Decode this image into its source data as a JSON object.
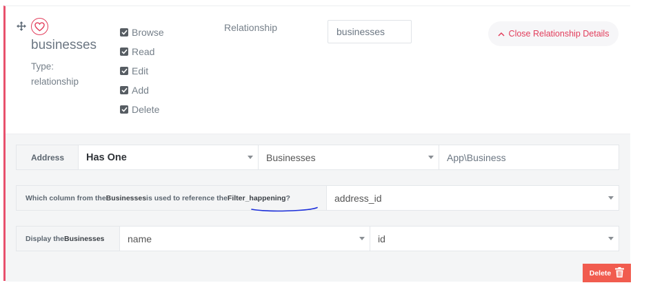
{
  "field": {
    "name": "businesses",
    "type_label": "Type:",
    "type_value": "relationship"
  },
  "permissions": [
    {
      "label": "Browse",
      "checked": true
    },
    {
      "label": "Read",
      "checked": true
    },
    {
      "label": "Edit",
      "checked": true
    },
    {
      "label": "Add",
      "checked": true
    },
    {
      "label": "Delete",
      "checked": true
    }
  ],
  "relationship": {
    "label": "Relationship",
    "display_name_value": "businesses",
    "close_button_label": "Close Relationship Details"
  },
  "details": {
    "row1": {
      "label": "Address",
      "relation_type": "Has One",
      "table": "Businesses",
      "model_value": "App\\Business"
    },
    "row2": {
      "label_prefix": "Which column from the ",
      "label_table": "Businesses",
      "label_middle": " is used to reference the ",
      "label_field": "Filter_happening",
      "label_suffix": "?",
      "column_value": "address_id"
    },
    "row3": {
      "label_prefix": "Display the ",
      "label_table": "Businesses",
      "display_value": "name",
      "key_value": "id"
    },
    "delete_label": "Delete"
  },
  "colors": {
    "accent": "#e8506c",
    "delete": "#f15c4f",
    "annotation": "#1a2ddb"
  },
  "icons": {
    "move": "move-arrows-icon",
    "field": "heart-icon",
    "close": "chevron-up-icon",
    "delete": "trash-icon"
  }
}
